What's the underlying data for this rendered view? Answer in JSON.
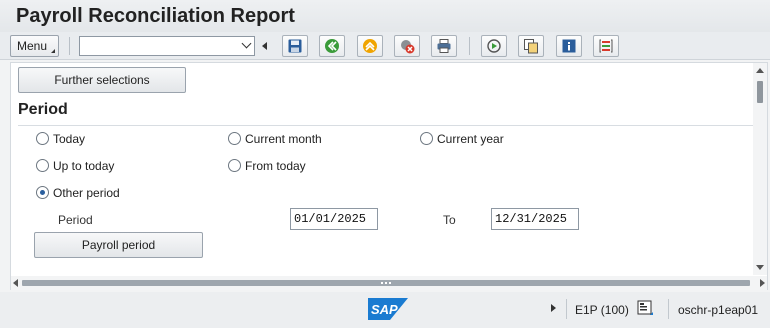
{
  "window": {
    "title": "Payroll Reconciliation Report"
  },
  "toolbar": {
    "menu_label": "Menu",
    "command_field": {
      "value": "",
      "placeholder": ""
    },
    "buttons": [
      {
        "name": "save-icon"
      },
      {
        "name": "back-icon"
      },
      {
        "name": "exit-icon"
      },
      {
        "name": "cancel-icon"
      },
      {
        "name": "print-icon"
      },
      {
        "name": "execute-icon"
      },
      {
        "name": "copy-variant-icon"
      },
      {
        "name": "info-icon"
      },
      {
        "name": "selection-options-icon"
      }
    ]
  },
  "main": {
    "further_selections_label": "Further selections",
    "section_title": "Period",
    "options": {
      "today": "Today",
      "current_month": "Current month",
      "current_year": "Current year",
      "up_to_today": "Up to today",
      "from_today": "From today",
      "other_period": "Other period"
    },
    "selected_option": "other_period",
    "period_label": "Period",
    "period_from": "01/01/2025",
    "to_label": "To",
    "period_to": "12/31/2025",
    "payroll_period_label": "Payroll period"
  },
  "statusbar": {
    "logo_text": "SAP",
    "system": "E1P (100)",
    "server": "oschr-p1eap01"
  },
  "colors": {
    "sap_blue": "#1a7bd1",
    "radio_selected": "#2b5f9e",
    "save_icon": "#2a5d9b",
    "back_green": "#3a9b3a",
    "exit_yellow": "#f0a400",
    "cancel_red": "#d8392b"
  }
}
